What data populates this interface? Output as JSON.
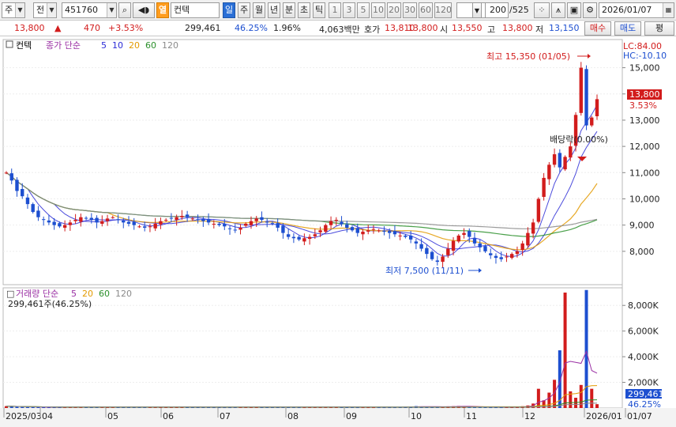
{
  "toolbar": {
    "market": "주",
    "type": "전",
    "code": "451760",
    "flag": "열",
    "name": "컨텍",
    "periods": [
      "일",
      "주",
      "월",
      "년",
      "분",
      "초",
      "틱"
    ],
    "intervals": [
      "1",
      "3",
      "5",
      "10",
      "20",
      "30",
      "60",
      "120"
    ],
    "count": "200",
    "count_total": "/525",
    "date": "2026/01/07"
  },
  "quote": {
    "price": "13,800",
    "change": "470",
    "change_pct": "+3.53%",
    "volume": "299,461",
    "volume_ratio": "46.25%",
    "turnover": "1.96%",
    "amount": "4,063백만",
    "bid_label": "호가",
    "bid": "13,810",
    "ask": "13,800",
    "open_label": "시",
    "open": "13,550",
    "high_label": "고",
    "high": "13,800",
    "low_label": "저",
    "low": "13,150",
    "buy_label": "매수",
    "sell_label": "매도",
    "eval_label": "평"
  },
  "price_panel": {
    "legend_name": "컨텍",
    "legend_ma": "종가 단순",
    "ma_periods": [
      "5",
      "10",
      "20",
      "60",
      "120"
    ],
    "ma_colors": [
      "#2b2bd6",
      "#2b2bd6",
      "#e39a00",
      "#2a8f2a",
      "#8a8a8a"
    ],
    "lc": "LC:84.00",
    "hc": "HC:-10.10",
    "high_marker": "최고 15,350 (01/05)",
    "low_marker": "최저 7,500 (11/11)",
    "dividend": "배당락(0.00%)",
    "current_price": "13,800",
    "current_pct": "3.53%",
    "y_ticks": [
      "15,000",
      "14,000",
      "13,000",
      "12,000",
      "11,000",
      "10,000",
      "9,000",
      "8,000"
    ]
  },
  "volume_panel": {
    "legend": "거래량 단순",
    "ma_periods": [
      "5",
      "20",
      "60",
      "120"
    ],
    "current_text": "299,461주(46.25%)",
    "current_value": "299,461",
    "current_pct": "46.25%",
    "y_ticks": [
      "8,000K",
      "6,000K",
      "4,000K",
      "2,000K"
    ]
  },
  "x_axis": [
    "2025/03",
    "04",
    "05",
    "06",
    "07",
    "08",
    "09",
    "10",
    "11",
    "12",
    "2026/01",
    "01/07"
  ],
  "chart_data": {
    "type": "candlestick",
    "x_range": [
      "2025/03",
      "2026/01/07"
    ],
    "ylim": [
      7500,
      15350
    ],
    "high": {
      "value": 15350,
      "date": "01/05"
    },
    "low": {
      "value": 7500,
      "date": "11/11"
    },
    "closes": [
      11000,
      10700,
      10300,
      10100,
      9800,
      9500,
      9300,
      9200,
      9100,
      9000,
      8950,
      9000,
      9100,
      9200,
      9300,
      9250,
      9200,
      9100,
      9150,
      9250,
      9300,
      9200,
      9100,
      9050,
      9000,
      8950,
      8900,
      8950,
      9050,
      9150,
      9200,
      9250,
      9300,
      9350,
      9300,
      9250,
      9200,
      9150,
      9100,
      9050,
      9000,
      8950,
      8850,
      8800,
      8900,
      9050,
      9150,
      9250,
      9200,
      9100,
      9050,
      8900,
      8700,
      8550,
      8500,
      8450,
      8500,
      8550,
      8650,
      8800,
      9000,
      9150,
      9200,
      9050,
      8900,
      8800,
      8700,
      8750,
      8800,
      8850,
      8800,
      8750,
      8700,
      8650,
      8600,
      8550,
      8450,
      8300,
      8100,
      7900,
      7700,
      7600,
      7800,
      8100,
      8400,
      8600,
      8700,
      8550,
      8300,
      8150,
      8000,
      7850,
      7750,
      7700,
      7800,
      7900,
      8000,
      8300,
      8700,
      9100,
      10000,
      10800,
      11300,
      11700,
      11200,
      11600,
      12000,
      13200,
      15000,
      12800,
      13100,
      13800
    ],
    "volumes_k": [
      150,
      120,
      100,
      90,
      80,
      80,
      70,
      60,
      60,
      60,
      60,
      60,
      70,
      80,
      90,
      90,
      80,
      70,
      70,
      80,
      90,
      90,
      80,
      70,
      70,
      70,
      70,
      70,
      80,
      80,
      90,
      90,
      100,
      90,
      80,
      80,
      70,
      70,
      70,
      60,
      60,
      60,
      60,
      70,
      80,
      90,
      90,
      90,
      80,
      70,
      70,
      70,
      80,
      80,
      70,
      60,
      60,
      70,
      70,
      80,
      90,
      100,
      90,
      80,
      80,
      70,
      60,
      60,
      60,
      60,
      60,
      60,
      60,
      60,
      70,
      80,
      110,
      150,
      120,
      90,
      80,
      90,
      110,
      130,
      140,
      160,
      120,
      100,
      90,
      80,
      70,
      60,
      60,
      60,
      70,
      80,
      100,
      140,
      200,
      350,
      1500,
      600,
      1200,
      2200,
      4500,
      9000,
      1300,
      800,
      1800,
      9200,
      1500,
      299
    ],
    "volume_ylim": [
      0,
      9000
    ]
  }
}
